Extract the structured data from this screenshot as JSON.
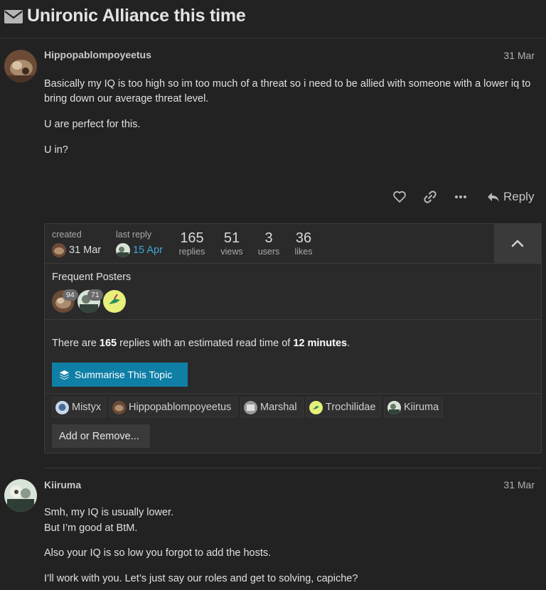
{
  "topic": {
    "title": "Unironic Alliance this time",
    "icon": "envelope-icon"
  },
  "posts": [
    {
      "author": "Hippopablompoyeetus",
      "date": "31 Mar",
      "paragraphs": [
        "Basically my IQ is too high so im too much of a threat so i need to be allied with someone with a lower iq to bring down our average threat level.",
        "U are perfect for this.",
        "U in?"
      ]
    },
    {
      "author": "Kiiruma",
      "date": "31 Mar",
      "paragraphs": [
        "Smh, my IQ is usually lower.",
        "But I’m good at BtM.",
        "Also your IQ is so low you forgot to add the hosts.",
        "I’ll work with you. Let’s just say our roles and get to solving, capiche?"
      ]
    }
  ],
  "actions": {
    "like_icon": "heart-icon",
    "link_icon": "link-icon",
    "more_icon": "ellipsis-icon",
    "reply_label": "Reply"
  },
  "topic_map": {
    "created_label": "created",
    "created_date": "31 Mar",
    "last_reply_label": "last reply",
    "last_reply_date": "15 Apr",
    "stats": [
      {
        "value": "165",
        "label": "replies"
      },
      {
        "value": "51",
        "label": "views"
      },
      {
        "value": "3",
        "label": "users"
      },
      {
        "value": "36",
        "label": "likes"
      }
    ],
    "frequent_posters_label": "Frequent Posters",
    "frequent_badges": [
      "94",
      "71"
    ],
    "summary_prefix": "There are ",
    "summary_replies": "165",
    "summary_middle": " replies with an estimated read time of ",
    "summary_time": "12 minutes",
    "summary_suffix": ".",
    "summarise_label": "Summarise This Topic",
    "participants": [
      "Mistyx",
      "Hippopablompoyeetus",
      "Marshal",
      "Trochilidae",
      "Kiiruma"
    ],
    "add_remove_label": "Add or Remove...",
    "link_color": "#3fa6d6",
    "button_color": "#0f7fa6"
  }
}
